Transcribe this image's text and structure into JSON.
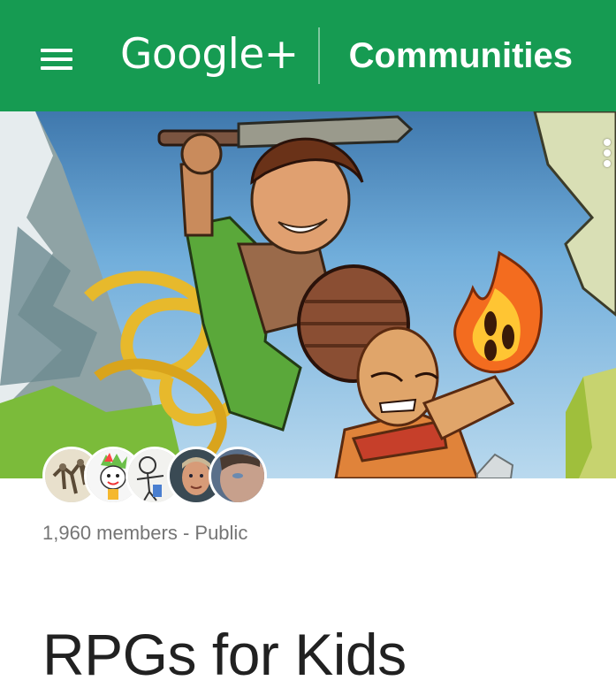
{
  "appbar": {
    "brand": "Google+",
    "section_title": "Communities",
    "menu_icon": "hamburger-menu-icon",
    "background": "#169b52"
  },
  "cover": {
    "more_icon": "more-vertical-icon"
  },
  "community": {
    "meta": "1,960 members - Public",
    "name": "RPGs for Kids"
  }
}
